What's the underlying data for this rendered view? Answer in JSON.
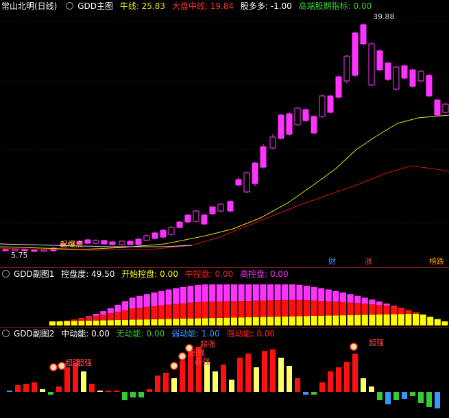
{
  "main_panel": {
    "stock_name": "常山北明(日线)",
    "indicator_name": "GDD主图",
    "legend": [
      {
        "label": "牛线: 25.83",
        "color": "#e6e600"
      },
      {
        "label": "大盘中线: 19.84",
        "color": "#ff3030"
      },
      {
        "label": "股多多: -1.00",
        "color": "#ffffff"
      },
      {
        "label": "高端股期指标: 0.00",
        "color": "#33cc33"
      }
    ],
    "high_label": "39.88",
    "low_label": "5.75",
    "signal_label": "起爆点",
    "flags": [
      {
        "text": "财",
        "color": "#3399ff"
      },
      {
        "text": "涨",
        "color": "#ff4444"
      },
      {
        "text": "榜跌",
        "color": "#ff9900"
      }
    ]
  },
  "sub1": {
    "name": "GDD副图1",
    "legend": [
      {
        "label": "控盘度: 49.50",
        "color": "#ffffff"
      },
      {
        "label": "开始控盘: 0.00",
        "color": "#ffff00"
      },
      {
        "label": "中控盘: 0.00",
        "color": "#ff2020"
      },
      {
        "label": "高控盘: 0.00",
        "color": "#ff33ff"
      }
    ]
  },
  "sub2": {
    "name": "GDD副图2",
    "legend": [
      {
        "label": "中动能: 0.00",
        "color": "#ffffff"
      },
      {
        "label": "无动能: 0.00",
        "color": "#33cc33"
      },
      {
        "label": "弱动能: 1.00",
        "color": "#3399ff"
      },
      {
        "label": "强动能: 0.00",
        "color": "#ff2020"
      }
    ],
    "tags": [
      "超强",
      "超强",
      "超强",
      "超强",
      "超强",
      "超强"
    ]
  },
  "colors": {
    "candle": "#ff33ff",
    "bull_line": "#e6e600",
    "mid_line": "#d81010",
    "grid": "#8a1a1a"
  }
}
